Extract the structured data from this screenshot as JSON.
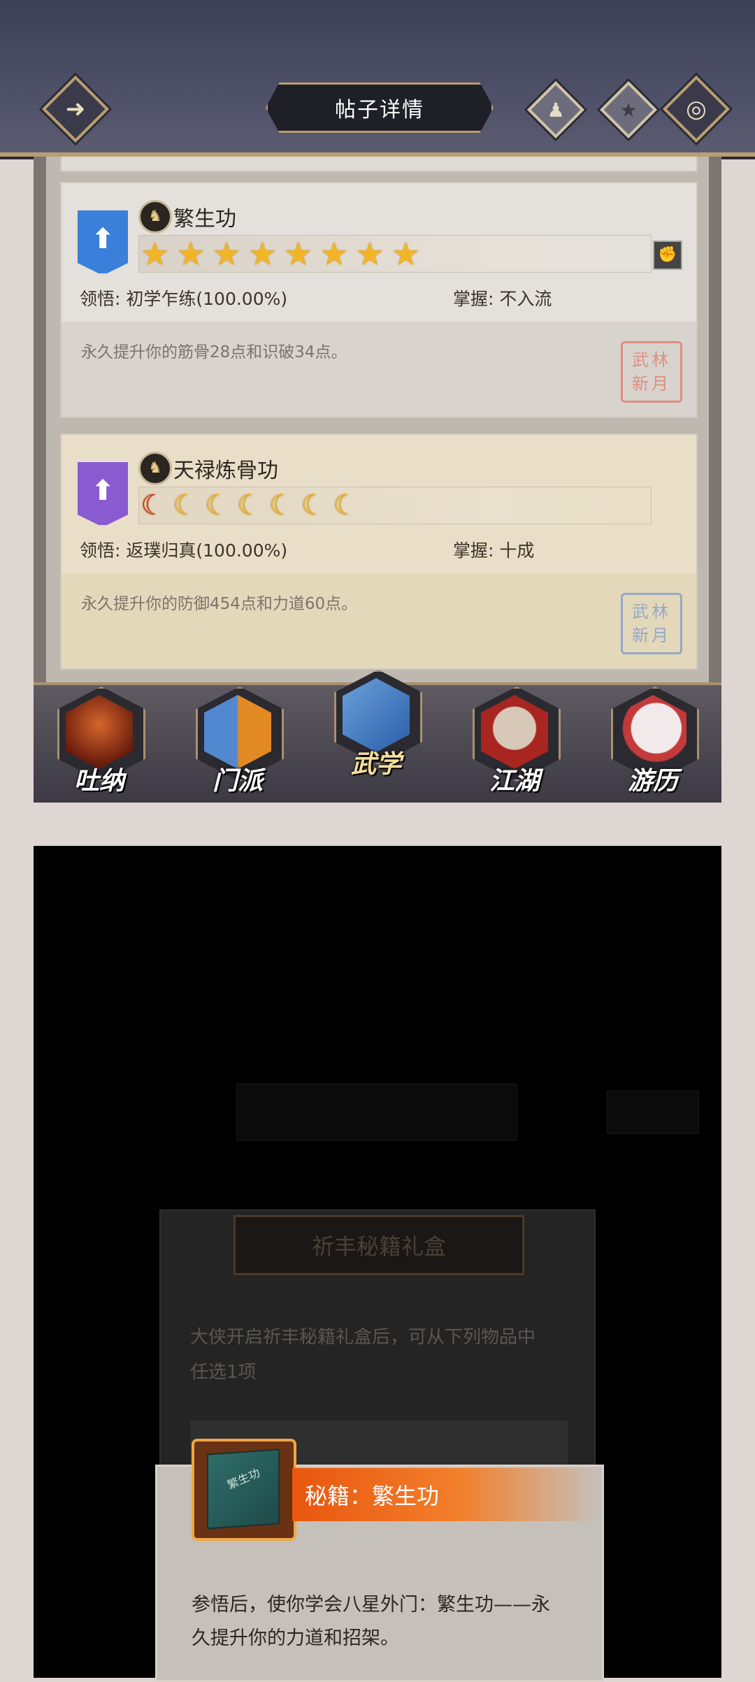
{
  "header": {
    "title": "帖子详情",
    "back_icon": "back-arrow-icon",
    "buttons": [
      "profile-icon",
      "favorite-star-icon",
      "target-icon"
    ]
  },
  "skills": [
    {
      "name": "繁生功",
      "banner_color": "#3a7fd9",
      "rating_type": "stars",
      "rating_count": 8,
      "comprehension_label": "领悟:",
      "comprehension_value": "初学乍练(100.00%)",
      "mastery_label": "掌握:",
      "mastery_value": "不入流",
      "description": "永久提升你的筋骨28点和识破34点。",
      "seal_text": "武林新月",
      "seal_color": "#e06a5a"
    },
    {
      "name": "天禄炼骨功",
      "banner_color": "#8a5ad0",
      "rating_type": "moons",
      "rating_count": 7,
      "comprehension_label": "领悟:",
      "comprehension_value": "返璞归真(100.00%)",
      "mastery_label": "掌握:",
      "mastery_value": "十成",
      "description": "永久提升你的防御454点和力道60点。",
      "seal_text": "武林新月",
      "seal_color": "#6a8fd0"
    }
  ],
  "nav": [
    {
      "label": "吐纳",
      "icon": "meditation-icon",
      "color": "#c2451e"
    },
    {
      "label": "门派",
      "icon": "sect-icon",
      "color": "#4c7fc9"
    },
    {
      "label": "武学",
      "icon": "martial-book-icon",
      "color": "#4a7bc0",
      "active": true
    },
    {
      "label": "江湖",
      "icon": "straw-hat-icon",
      "color": "#b52a22"
    },
    {
      "label": "游历",
      "icon": "horse-icon",
      "color": "#e7d7d5"
    }
  ],
  "dialog": {
    "title": "祈丰秘籍礼盒",
    "intro_line1": "大侠开启祈丰秘籍礼盒后，可从下列物品中",
    "intro_line2": "任选1项",
    "item_name": "秘籍：繁生功",
    "item_book_text": "繁生功",
    "item_desc_line1": "参悟后，使你学会八星外门：繁生功——永",
    "item_desc_line2": "久提升你的力道和招架。"
  }
}
